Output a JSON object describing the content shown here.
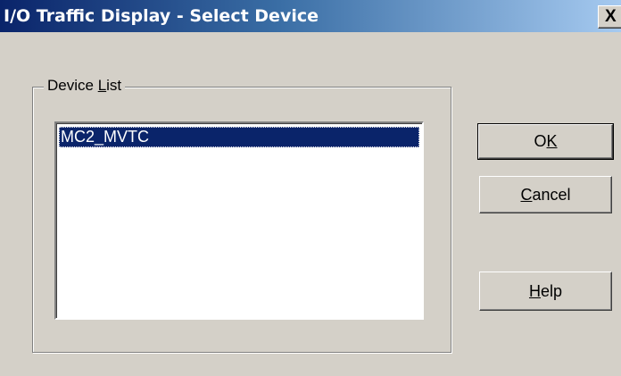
{
  "window": {
    "title": "I/O Traffic Display - Select Device",
    "close_glyph": "X"
  },
  "device_group": {
    "label_prefix": "Device ",
    "label_mnemonic": "L",
    "label_suffix": "ist",
    "items": [
      "MC2_MVTC"
    ],
    "selected_index": 0
  },
  "buttons": {
    "ok": {
      "prefix": "O",
      "mnemonic": "K",
      "suffix": ""
    },
    "cancel": {
      "prefix": "",
      "mnemonic": "C",
      "suffix": "ancel"
    },
    "help": {
      "prefix": "",
      "mnemonic": "H",
      "suffix": "elp"
    }
  },
  "colors": {
    "selection_bg": "#0a246a",
    "selection_text": "#ffffff",
    "titlebar_start": "#0a246a",
    "titlebar_end": "#a6caf0",
    "dialog_face": "#d4d0c8"
  }
}
